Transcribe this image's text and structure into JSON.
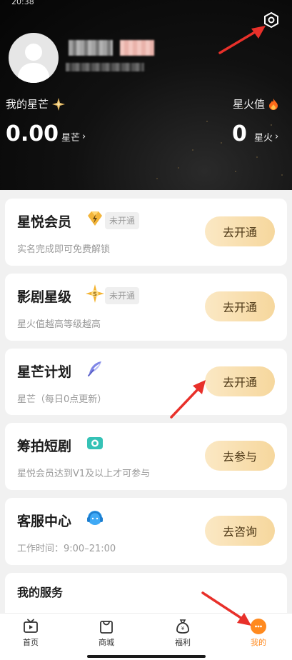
{
  "status_bar": {
    "time": "20:38"
  },
  "header": {
    "my_xingmang_label": "我的星芒",
    "xingmang_value": "0.00",
    "xingmang_unit": "星芒",
    "xinghuo_label": "星火值",
    "xinghuo_value": "0",
    "xinghuo_unit": "星火"
  },
  "cards": [
    {
      "title": "星悦会员",
      "badge": "未开通",
      "desc": "实名完成即可免费解锁",
      "button": "去开通",
      "icon": "diamond-icon"
    },
    {
      "title": "影剧星级",
      "badge": "未开通",
      "desc": "星火值越高等级越高",
      "button": "去开通",
      "icon": "star-icon"
    },
    {
      "title": "星芒计划",
      "badge": "",
      "desc": "星芒（每日0点更新）",
      "button": "去开通",
      "icon": "feather-icon"
    },
    {
      "title": "筹拍短剧",
      "badge": "",
      "desc": "星悦会员达到V1及以上才可参与",
      "button": "去参与",
      "icon": "camera-icon"
    },
    {
      "title": "客服中心",
      "badge": "",
      "desc": "工作时间：9:00–21:00",
      "button": "去咨询",
      "icon": "headset-icon"
    }
  ],
  "services": {
    "title": "我的服务"
  },
  "tabbar": {
    "items": [
      {
        "label": "首页",
        "icon": "tv-icon"
      },
      {
        "label": "商城",
        "icon": "bag-icon"
      },
      {
        "label": "福利",
        "icon": "money-bag-icon"
      },
      {
        "label": "我的",
        "icon": "profile-icon"
      }
    ],
    "active_index": 3
  },
  "colors": {
    "accent": "#ff8a1f",
    "button_gold": "#f6d79d",
    "header_bg": "#0b0b0b"
  }
}
